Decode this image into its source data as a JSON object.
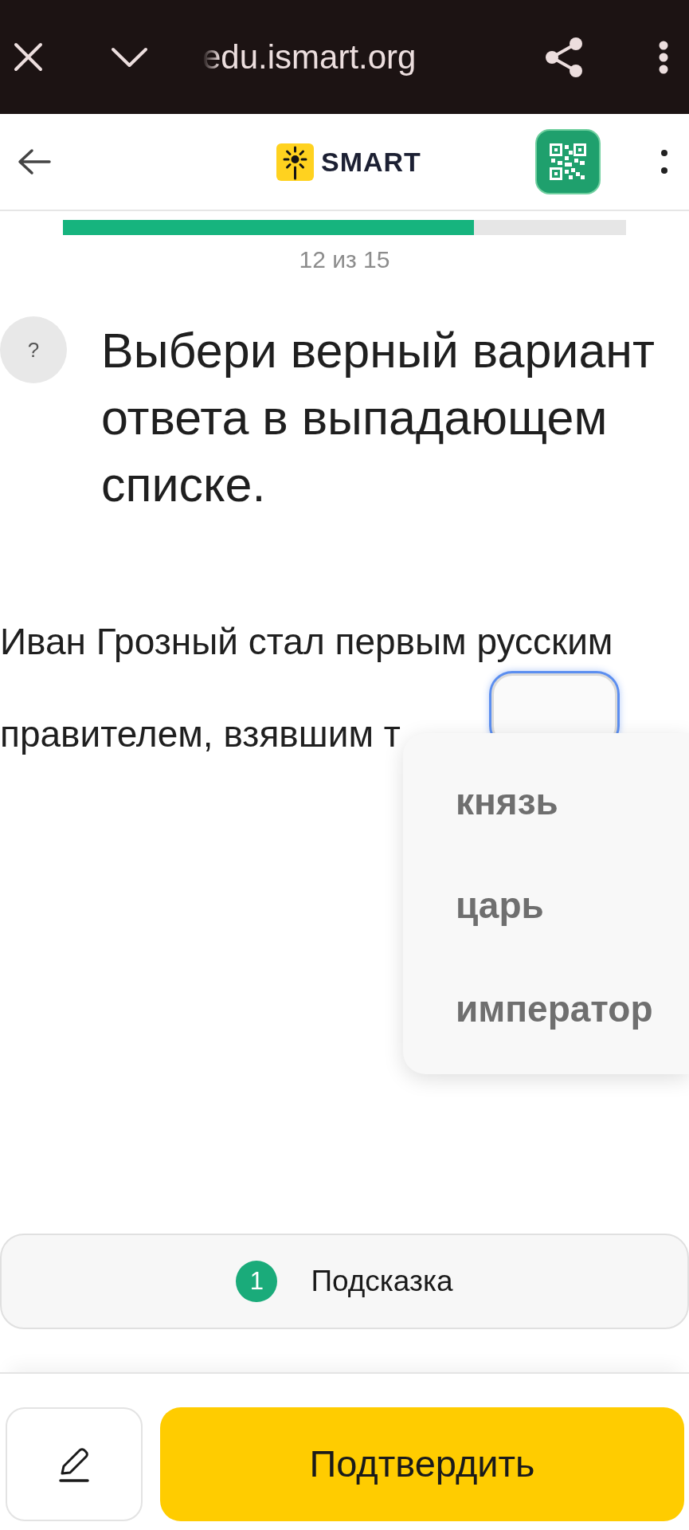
{
  "browser_bar": {
    "url": "edu.ismart.org"
  },
  "app_header": {
    "logo_text": "SMART"
  },
  "progress": {
    "level": 0.73,
    "counter": "12 из 15"
  },
  "question": {
    "help_symbol": "?",
    "title": "Выбери верный вариант ответа в выпадающем списке."
  },
  "sentence": {
    "lines": [
      "Иван Грозный стал первым русским",
      "правителем, взявшим т"
    ],
    "answer_select": {
      "focused": true,
      "expanded": true,
      "options": [
        {
          "label": "князь",
          "selected": false
        },
        {
          "label": "царь",
          "selected": false
        },
        {
          "label": "император",
          "selected": false
        }
      ]
    }
  },
  "hint_button": {
    "count": "1",
    "label": "Подсказка"
  },
  "bottom_bar": {
    "confirm_label": "Подтвердить"
  }
}
